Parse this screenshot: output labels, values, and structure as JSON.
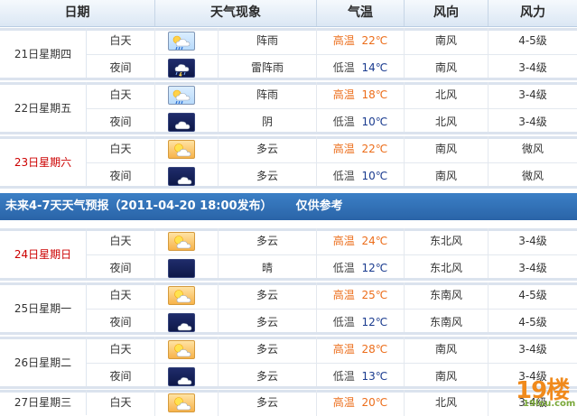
{
  "header": {
    "date": "日期",
    "weather": "天气现象",
    "temperature": "气温",
    "wind_direction": "风向",
    "wind_force": "风力"
  },
  "banner": {
    "title": "未来4-7天天气预报（2011-04-20 18:00发布）",
    "note": "仅供参考"
  },
  "days": [
    {
      "date": "21日星期四",
      "weekend": false,
      "day": {
        "period": "白天",
        "icon": "showers-day-icon",
        "desc": "阵雨",
        "temp_label": "高温",
        "temp": "22℃",
        "wind": "南风",
        "force": "4-5级"
      },
      "night": {
        "period": "夜间",
        "icon": "thunder-shower-icon",
        "desc": "雷阵雨",
        "temp_label": "低温",
        "temp": "14℃",
        "wind": "南风",
        "force": "3-4级"
      }
    },
    {
      "date": "22日星期五",
      "weekend": false,
      "day": {
        "period": "白天",
        "icon": "showers-day-icon",
        "desc": "阵雨",
        "temp_label": "高温",
        "temp": "18℃",
        "wind": "北风",
        "force": "3-4级"
      },
      "night": {
        "period": "夜间",
        "icon": "overcast-night-icon",
        "desc": "阴",
        "temp_label": "低温",
        "temp": "10℃",
        "wind": "北风",
        "force": "3-4级"
      }
    },
    {
      "date": "23日星期六",
      "weekend": true,
      "day": {
        "period": "白天",
        "icon": "partly-cloudy-day-icon",
        "desc": "多云",
        "temp_label": "高温",
        "temp": "22℃",
        "wind": "南风",
        "force": "微风"
      },
      "night": {
        "period": "夜间",
        "icon": "partly-cloudy-night-icon",
        "desc": "多云",
        "temp_label": "低温",
        "temp": "10℃",
        "wind": "南风",
        "force": "微风"
      }
    },
    {
      "date": "24日星期日",
      "weekend": true,
      "day": {
        "period": "白天",
        "icon": "partly-cloudy-day-icon",
        "desc": "多云",
        "temp_label": "高温",
        "temp": "24℃",
        "wind": "东北风",
        "force": "3-4级"
      },
      "night": {
        "period": "夜间",
        "icon": "clear-night-icon",
        "desc": "晴",
        "temp_label": "低温",
        "temp": "12℃",
        "wind": "东北风",
        "force": "3-4级"
      }
    },
    {
      "date": "25日星期一",
      "weekend": false,
      "day": {
        "period": "白天",
        "icon": "partly-cloudy-day-icon",
        "desc": "多云",
        "temp_label": "高温",
        "temp": "25℃",
        "wind": "东南风",
        "force": "4-5级"
      },
      "night": {
        "period": "夜间",
        "icon": "partly-cloudy-night-icon",
        "desc": "多云",
        "temp_label": "低温",
        "temp": "12℃",
        "wind": "东南风",
        "force": "4-5级"
      }
    },
    {
      "date": "26日星期二",
      "weekend": false,
      "day": {
        "period": "白天",
        "icon": "partly-cloudy-day-icon",
        "desc": "多云",
        "temp_label": "高温",
        "temp": "28℃",
        "wind": "南风",
        "force": "3-4级"
      },
      "night": {
        "period": "夜间",
        "icon": "partly-cloudy-night-icon",
        "desc": "多云",
        "temp_label": "低温",
        "temp": "13℃",
        "wind": "南风",
        "force": "3-4级"
      }
    },
    {
      "date": "27日星期三",
      "weekend": false,
      "day": {
        "period": "白天",
        "icon": "partly-cloudy-day-icon",
        "desc": "多云",
        "temp_label": "高温",
        "temp": "20℃",
        "wind": "北风",
        "force": "3-4级"
      }
    }
  ],
  "watermark": {
    "big": "19楼",
    "small": "19lou.com"
  }
}
